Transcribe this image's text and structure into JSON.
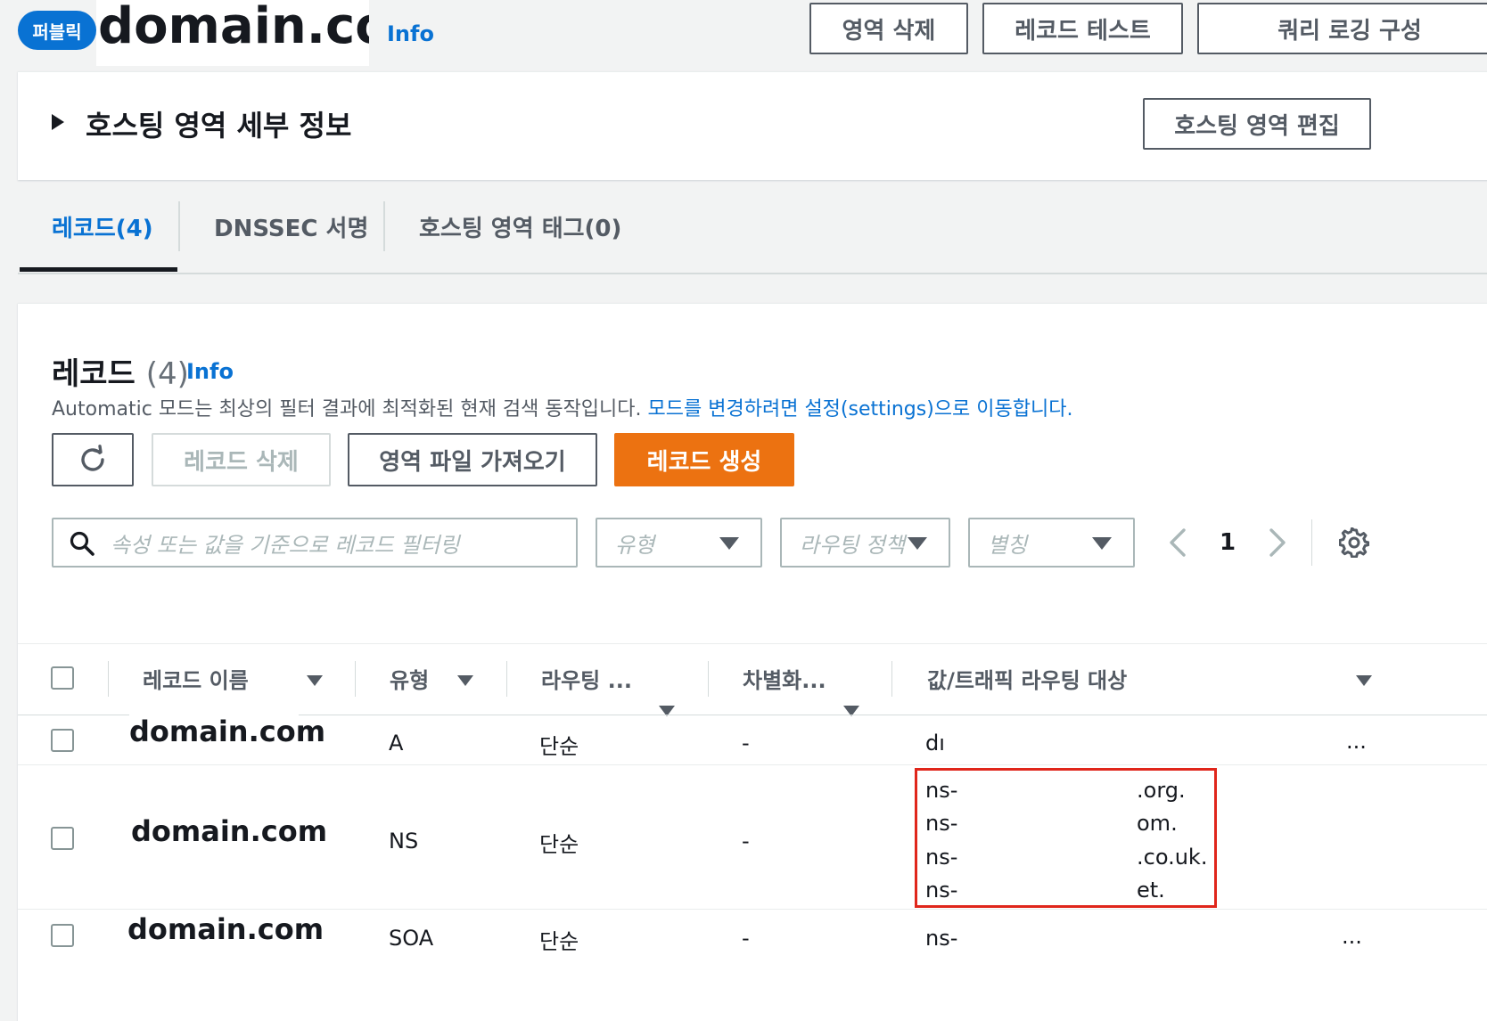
{
  "header": {
    "badge": "퍼블릭",
    "title": "domain.com",
    "info": "Info",
    "buttons": [
      "영역 삭제",
      "레코드 테스트",
      "쿼리 로깅 구성"
    ]
  },
  "details": {
    "title": "호스팅 영역 세부 정보",
    "edit_button": "호스팅 영역 편집"
  },
  "tabs": [
    {
      "label": "레코드(4)",
      "active": true
    },
    {
      "label": "DNSSEC 서명",
      "active": false
    },
    {
      "label": "호스팅 영역 태그(0)",
      "active": false
    }
  ],
  "records": {
    "title": "레코드",
    "count": "(4)",
    "info": "Info",
    "description": "Automatic 모드는 최상의 필터 결과에 최적화된 현재 검색 동작입니다.",
    "description_link": "모드를 변경하려면 설정(settings)으로 이동합니다.",
    "buttons": {
      "delete": "레코드 삭제",
      "import": "영역 파일 가져오기",
      "create": "레코드 생성"
    },
    "filter": {
      "search_placeholder": "속성 또는 값을 기준으로 레코드 필터링",
      "type": "유형",
      "routing": "라우팅 정책",
      "alias": "별칭"
    },
    "pagination": {
      "page": "1"
    },
    "columns": [
      "레코드 이름",
      "유형",
      "라우팅 ...",
      "차별화...",
      "값/트래픽 라우팅 대상"
    ],
    "rows": [
      {
        "name": "domain.com",
        "type": "A",
        "routing": "단순",
        "diff": "-",
        "value": [
          "dı"
        ],
        "more": "..."
      },
      {
        "name": "domain.com",
        "type": "NS",
        "routing": "단순",
        "diff": "-",
        "value": [
          "ns-",
          "ns-",
          "ns-",
          "ns-"
        ],
        "value_suffix": [
          ".org.",
          "om.",
          ".co.uk.",
          "et."
        ]
      },
      {
        "name": "domain.com",
        "type": "SOA",
        "routing": "단순",
        "diff": "-",
        "value": [
          "ns-"
        ],
        "more": "..."
      }
    ]
  },
  "colors": {
    "accent": "#0972d3",
    "primary_button": "#ec7211",
    "highlight_box": "#e0261b"
  }
}
